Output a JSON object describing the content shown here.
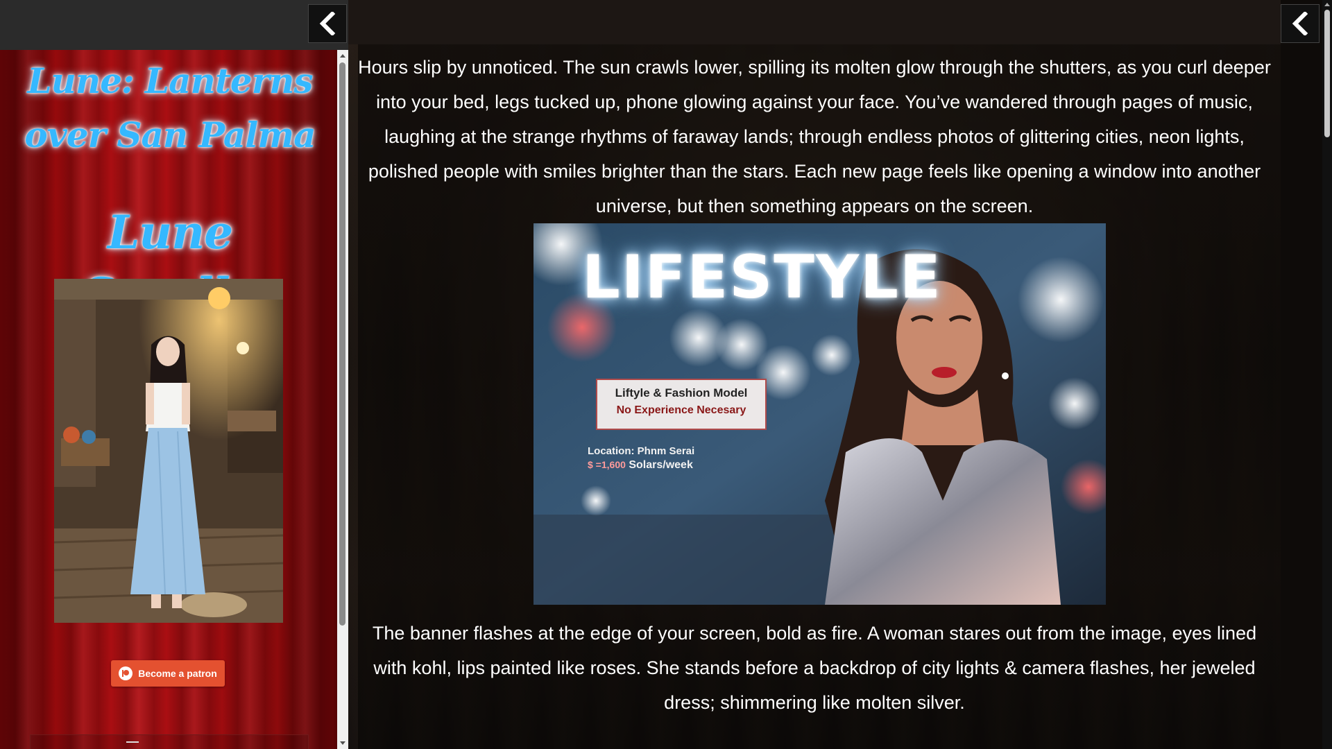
{
  "sidebar": {
    "title": "Lune: Lanterns over San Palma",
    "character_name": "Lune Sorelle",
    "patron_button_label": "Become a patron"
  },
  "icons": {
    "sidebar_back": "chevron-left-icon",
    "main_back": "chevron-left-icon",
    "patreon": "patreon-icon"
  },
  "story": {
    "paragraph_1": "Hours slip by unnoticed. The sun crawls lower, spilling its molten glow through the shutters, as you curl deeper into your bed, legs tucked up, phone glowing against your face. You’ve wandered through pages of music, laughing at the strange rhythms of faraway lands; through endless photos of glittering cities, neon lights, polished people with smiles brighter than the stars. Each new page feels like opening a window into another universe, but then something appears on the screen.",
    "image": {
      "headline": "LIFESTYLE",
      "box_line_1": "Liftyle & Fashion Model",
      "box_line_2": "No Experience Necesary",
      "location": "Location: Phnm Serai",
      "pay_amount": "$ =1,600",
      "pay_unit": "Solars/week"
    },
    "paragraph_2": "The banner flashes at the edge of your screen, bold as fire. A woman stares out from the image, eyes lined with kohl, lips painted like roses. She stands before a backdrop of city lights & camera flashes, her jeweled dress; shimmering like molten silver."
  },
  "colors": {
    "sidebar_red": "#a30c10",
    "title_blue": "#35b8ff",
    "patron_orange": "#e45130",
    "text_white": "#ffffff"
  }
}
